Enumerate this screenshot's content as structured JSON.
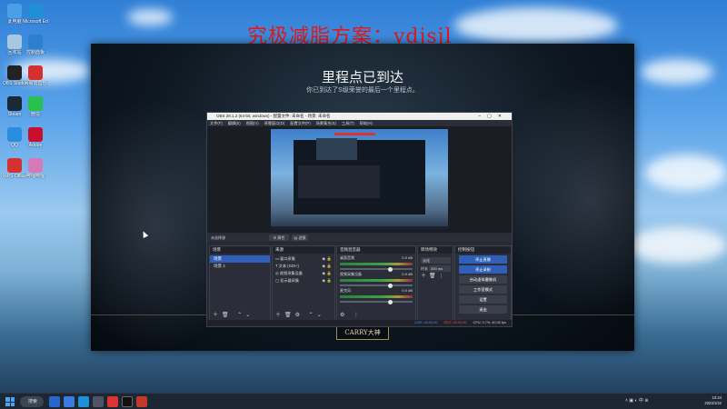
{
  "overlay": {
    "title": "究极减脂方案：ydjsjl"
  },
  "popup": {
    "title": "里程点已到达",
    "subtitle": "你已到达了S级荣誉的最后一个里程点。",
    "button_label": "CARRY大神"
  },
  "obs": {
    "window_title": "OBS 28.1.2 (64-bit, windows) - 配置文件: 未命名 - 场景: 未命名",
    "menu": [
      "文件(F)",
      "编辑(E)",
      "视图(V)",
      "停靠窗口(D)",
      "配置文件(P)",
      "场景集合(S)",
      "工具(T)",
      "帮助(H)"
    ],
    "controls": {
      "source_label": "未选择源",
      "properties": "属性",
      "filters": "滤镜"
    },
    "docks": {
      "scenes": {
        "header": "场景",
        "items": [
          "场景",
          "场景 2"
        ],
        "selected": 0
      },
      "sources": {
        "header": "来源",
        "items": [
          "窗口采集",
          "文本 (GDI+)",
          "视频采集设备",
          "显示器采集"
        ]
      },
      "mixer": {
        "header": "音频混音器",
        "channels": [
          {
            "name": "桌面音频",
            "db": "0.0 dB"
          },
          {
            "name": "视频采集设备",
            "db": "0.0 dB"
          },
          {
            "name": "麦克风",
            "db": "0.0 dB"
          }
        ]
      },
      "transitions": {
        "header": "转场特效",
        "type": "淡化",
        "duration_label": "时长",
        "duration_value": "300 ms"
      },
      "controls": {
        "header": "控制按钮",
        "buttons": [
          "停止直播",
          "停止录制",
          "启动虚拟摄像机",
          "工作室模式",
          "设置",
          "退出"
        ]
      }
    },
    "status": {
      "live": "LIVE: 00:00:00",
      "rec": "REC: 00:00:00",
      "cpu": "CPU: 0.7%, 60.00 fps"
    }
  },
  "desktop_icons": [
    {
      "label": "此电脑",
      "color": "#4aa0e8"
    },
    {
      "label": "Microsoft Edge",
      "color": "#1f8fd8"
    },
    {
      "label": "回收站",
      "color": "#a8c7e0"
    },
    {
      "label": "控制面板",
      "color": "#2f7fcf"
    },
    {
      "label": "OBS Studio",
      "color": "#222222"
    },
    {
      "label": "网易云音乐",
      "color": "#d62f2f"
    },
    {
      "label": "Steam",
      "color": "#1b2838"
    },
    {
      "label": "微信",
      "color": "#27c24c"
    },
    {
      "label": "QQ",
      "color": "#2a8de0"
    },
    {
      "label": "Adobe",
      "color": "#c8102e"
    },
    {
      "label": "WPS Office",
      "color": "#d33232"
    },
    {
      "label": "哔哩哔哩",
      "color": "#d57ab9"
    }
  ],
  "taskbar": {
    "search_label": "搜索",
    "clock_time": "10:24",
    "clock_date": "2023/1/22"
  }
}
